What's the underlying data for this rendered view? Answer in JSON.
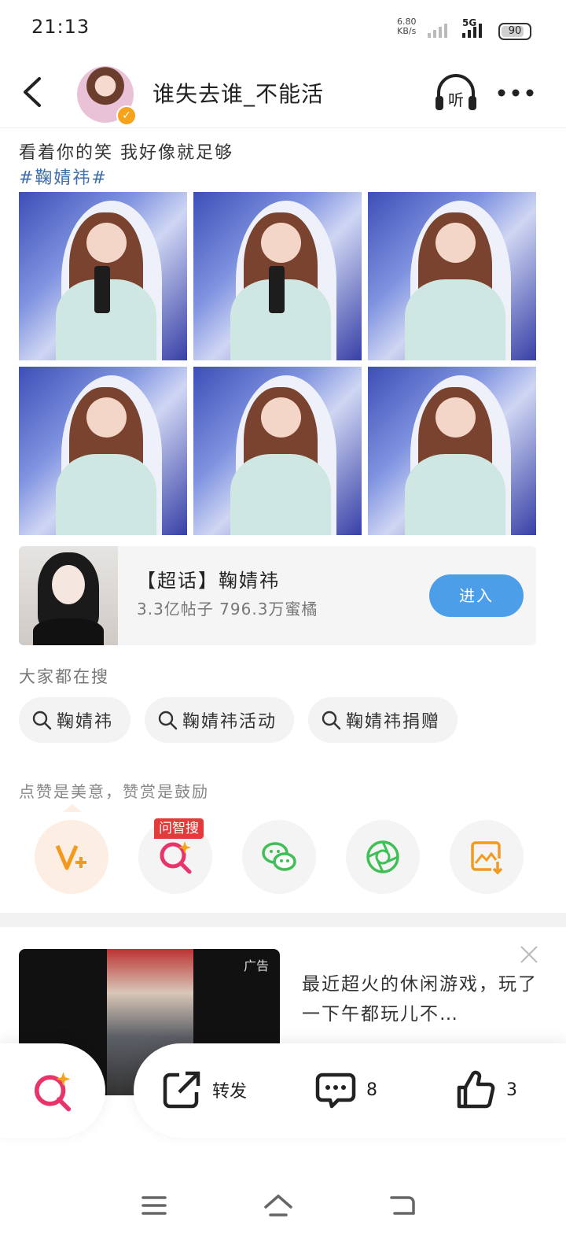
{
  "status_bar": {
    "time": "21:13",
    "net_speed_value": "6.80",
    "net_speed_unit": "KB/s",
    "network": "5G",
    "battery": "90"
  },
  "header": {
    "username": "谁失去谁_不能活",
    "listen_label": "听"
  },
  "post": {
    "text": "看着你的笑 我好像就足够",
    "topic": "#鞠婧祎#",
    "photo_count": 6
  },
  "super_topic": {
    "title": "【超话】鞠婧祎",
    "stats": "3.3亿帖子  796.3万蜜橘",
    "enter_label": "进入"
  },
  "search": {
    "label": "大家都在搜",
    "chips": [
      "鞠婧祎",
      "鞠婧祎活动",
      "鞠婧祎捐赠"
    ]
  },
  "reward": {
    "text": "点赞是美意，赞赏是鼓励",
    "zhisou_badge": "问智搜"
  },
  "ad": {
    "label": "广告",
    "text": "最近超火的休闲游戏，玩了一下午都玩儿不…"
  },
  "bottom_bar": {
    "repost_label": "转发",
    "comment_count": "8",
    "like_count": "3"
  },
  "colors": {
    "accent_blue": "#4d9ee8",
    "topic_blue": "#3e6ea7",
    "badge_red": "#e53a3a",
    "reward_orange": "#f39a1e",
    "wechat_green": "#3fbf55",
    "zhisou_pink": "#e8346a"
  }
}
